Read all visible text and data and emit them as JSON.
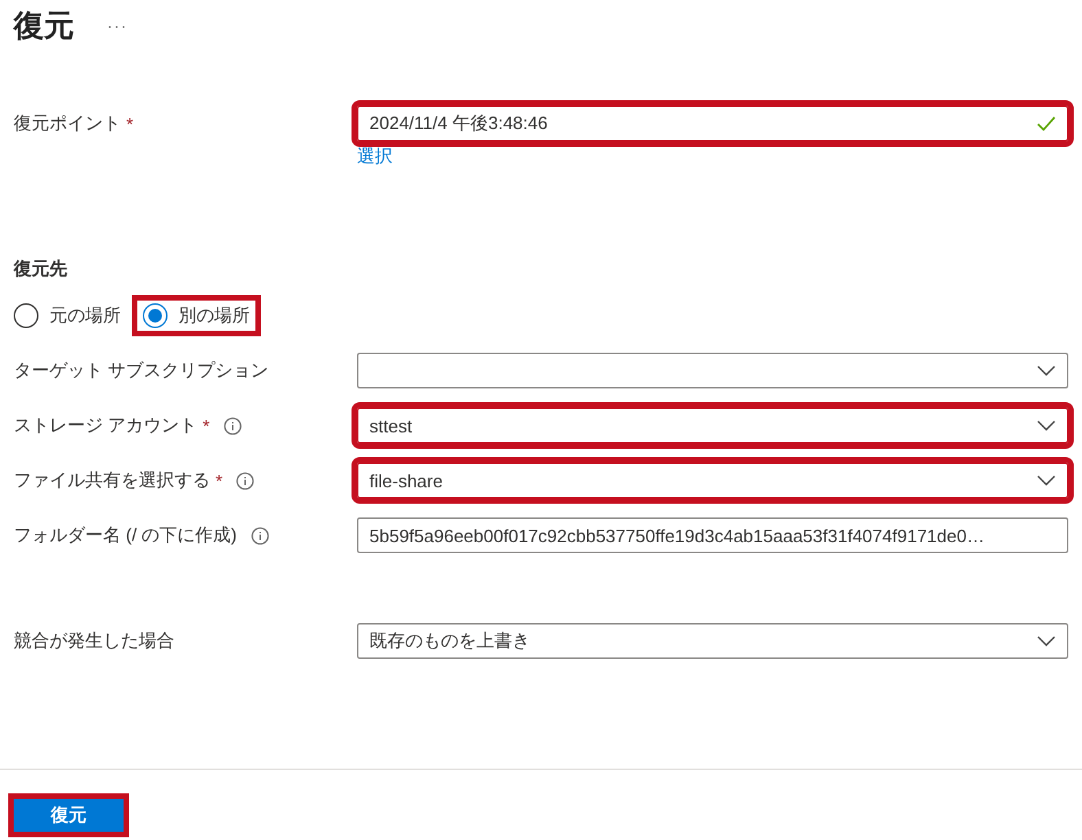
{
  "header": {
    "title": "復元",
    "more": "···"
  },
  "restore_point": {
    "label": "復元ポイント",
    "required_mark": "*",
    "value": "2024/11/4 午後3:48:46",
    "valid": true,
    "highlighted": true,
    "link": "選択"
  },
  "destination": {
    "heading": "復元先",
    "options": [
      {
        "label": "元の場所",
        "selected": false,
        "highlighted": false
      },
      {
        "label": "別の場所",
        "selected": true,
        "highlighted": true
      }
    ]
  },
  "fields": [
    {
      "kind": "dropdown",
      "label": "ターゲット サブスクリプション",
      "highlighted": false
    },
    {
      "kind": "dropdown",
      "label": "ストレージ アカウント",
      "required_mark": "*",
      "info": true,
      "value": "sttest",
      "highlighted": true
    },
    {
      "kind": "dropdown",
      "label": "ファイル共有を選択する",
      "required_mark": "*",
      "info": true,
      "value": "file-share",
      "highlighted": true
    },
    {
      "kind": "text",
      "label": "フォルダー名 (/ の下に作成)",
      "info": true,
      "value": "5b59f5a96eeb00f017c92cbb537750ffe19d3c4ab15aaa53f31f4074f9171de0…",
      "highlighted": false
    }
  ],
  "conflict": {
    "kind": "dropdown",
    "label": "競合が発生した場合",
    "value": "既存のものを上書き",
    "highlighted": false
  },
  "actions": {
    "restore": {
      "label": "復元",
      "highlighted": true
    }
  }
}
